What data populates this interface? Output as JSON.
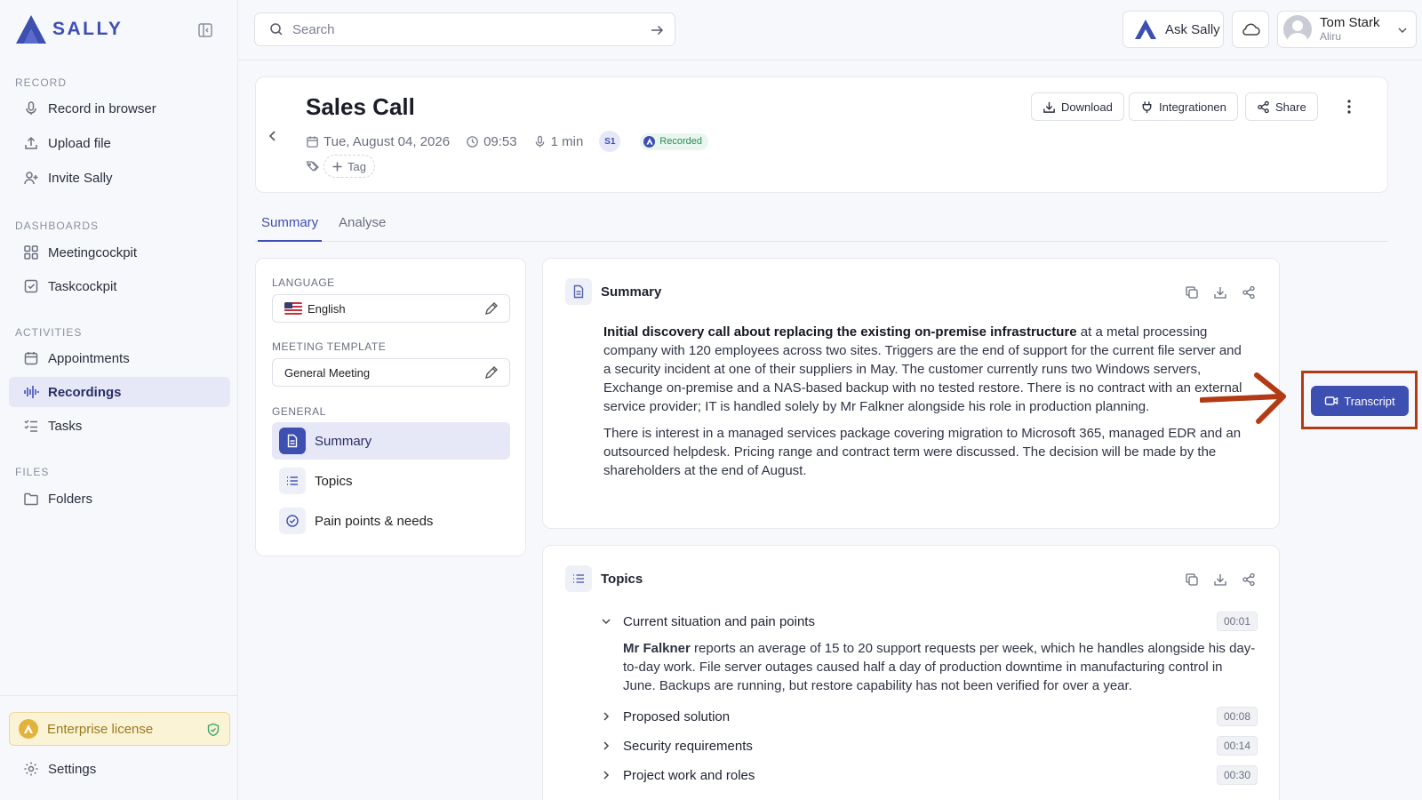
{
  "brand": {
    "name": "SALLY",
    "color": "#3d4fb0"
  },
  "sidebar": {
    "sections": {
      "record": "RECORD",
      "dashboards": "DASHBOARDS",
      "activities": "ACTIVITIES",
      "files": "FILES"
    },
    "items": {
      "record_browser": "Record in browser",
      "upload_file": "Upload file",
      "invite_sally": "Invite Sally",
      "meetingcockpit": "Meetingcockpit",
      "taskcockpit": "Taskcockpit",
      "appointments": "Appointments",
      "recordings": "Recordings",
      "tasks": "Tasks",
      "folders": "Folders"
    },
    "license": "Enterprise license",
    "settings": "Settings"
  },
  "topbar": {
    "search_placeholder": "Search",
    "ask": "Ask Sally",
    "user_name": "Tom Stark",
    "user_org": "Aliru"
  },
  "recording": {
    "title": "Sales Call",
    "date": "Tue, August 04, 2026",
    "time": "09:53",
    "duration": "1 min",
    "speaker": "S1",
    "status": "Recorded",
    "tag_label": "Tag",
    "download": "Download",
    "integrations": "Integrationen",
    "share": "Share"
  },
  "tabs": {
    "summary": "Summary",
    "analyse": "Analyse"
  },
  "panel": {
    "language_label": "LANGUAGE",
    "language_value": "English",
    "template_label": "MEETING TEMPLATE",
    "template_value": "General Meeting",
    "general_label": "GENERAL",
    "sections": {
      "summary": "Summary",
      "topics": "Topics",
      "pain_points": "Pain points & needs"
    }
  },
  "summary": {
    "title": "Summary",
    "p1_bold": "Initial discovery call about replacing the existing on-premise infrastructure",
    "p1_rest": " at a metal processing company with 120 employees across two sites. Triggers are the end of support for the current file server and a security incident at one of their suppliers in May. The customer currently runs two Windows servers, Exchange on-premise and a NAS-based backup with no tested restore. There is no contract with an external service provider; IT is handled solely by Mr Falkner alongside his role in production planning.",
    "p2": "There is interest in a managed services package covering migration to Microsoft 365, managed EDR and an outsourced helpdesk. Pricing range and contract term were discussed. The decision will be made by the shareholders at the end of August."
  },
  "topics": {
    "title": "Topics",
    "items": [
      {
        "label": "Current situation and pain points",
        "time": "00:01",
        "body_bold": "Mr Falkner",
        "body_rest": " reports an average of 15 to 20 support requests per week, which he handles alongside his day-to-day work. File server outages caused half a day of production downtime in manufacturing control in June. Backups are running, but restore capability has not been verified for over a year."
      },
      {
        "label": "Proposed solution",
        "time": "00:08"
      },
      {
        "label": "Security requirements",
        "time": "00:14"
      },
      {
        "label": "Project work and roles",
        "time": "00:30"
      }
    ]
  },
  "transcript_button": "Transcript",
  "annotation_color": "#b23a14"
}
